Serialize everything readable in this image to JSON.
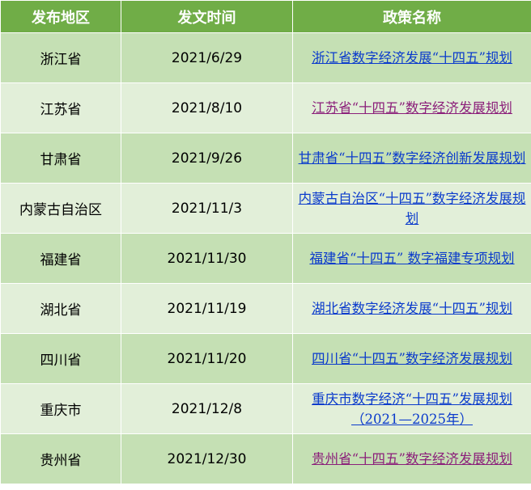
{
  "table": {
    "headers": [
      "发布地区",
      "发文时间",
      "政策名称"
    ],
    "rows": [
      {
        "region": "浙江省",
        "date": "2021/6/29",
        "policy": "浙江省数字经济发展“十四五”规划",
        "visited": false
      },
      {
        "region": "江苏省",
        "date": "2021/8/10",
        "policy": "江苏省“十四五”数字经济发展规划",
        "visited": true
      },
      {
        "region": "甘肃省",
        "date": "2021/9/26",
        "policy": "甘肃省“十四五”数字经济创新发展规划",
        "visited": false
      },
      {
        "region": "内蒙古自治区",
        "date": "2021/11/3",
        "policy": "内蒙古自治区“十四五”数字经济发展规划",
        "visited": false
      },
      {
        "region": "福建省",
        "date": "2021/11/30",
        "policy": "福建省“十四五” 数字福建专项规划",
        "visited": false
      },
      {
        "region": "湖北省",
        "date": "2021/11/19",
        "policy": "湖北省数字经济发展“十四五”规划",
        "visited": false
      },
      {
        "region": "四川省",
        "date": "2021/11/20",
        "policy": "四川省“十四五”数字经济发展规划",
        "visited": false
      },
      {
        "region": "重庆市",
        "date": "2021/12/8",
        "policy": "重庆市数字经济“十四五”发展规划（2021—2025年）",
        "visited": false
      },
      {
        "region": "贵州省",
        "date": "2021/12/30",
        "policy": "贵州省“十四五”数字经济发展规划",
        "visited": true
      }
    ]
  },
  "colors": {
    "header_bg": "#70ad47",
    "row_odd_bg": "#c5e0b4",
    "row_even_bg": "#e2efd9",
    "link": "#0b3bcc",
    "link_visited": "#8b1f7a"
  }
}
